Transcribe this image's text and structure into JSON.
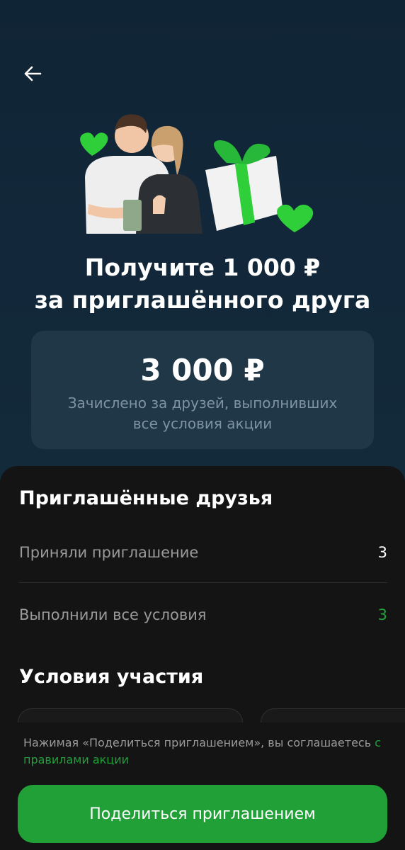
{
  "header": {
    "back_icon": "arrow-left-icon"
  },
  "hero": {
    "title_line1": "Получите 1 000 ₽",
    "title_line2": "за приглашённого друга"
  },
  "balance": {
    "amount": "3 000 ₽",
    "caption_line1": "Зачислено за друзей, выполнивших",
    "caption_line2": "все условия акции"
  },
  "friends": {
    "title": "Приглашённые друзья",
    "rows": [
      {
        "label": "Приняли приглашение",
        "value": "3"
      },
      {
        "label": "Выполнили все условия",
        "value": "3"
      }
    ]
  },
  "conditions": {
    "title": "Условия участия"
  },
  "legal": {
    "text": "Нажимая «Поделиться приглашением», вы соглашаетесь ",
    "link": "с правилами акции"
  },
  "share_button": {
    "label": "Поделиться приглашением"
  },
  "colors": {
    "accent_green": "#21a038",
    "hero_bg": "#102533",
    "card_bg": "#1f3747",
    "sheet_bg": "#141414"
  }
}
